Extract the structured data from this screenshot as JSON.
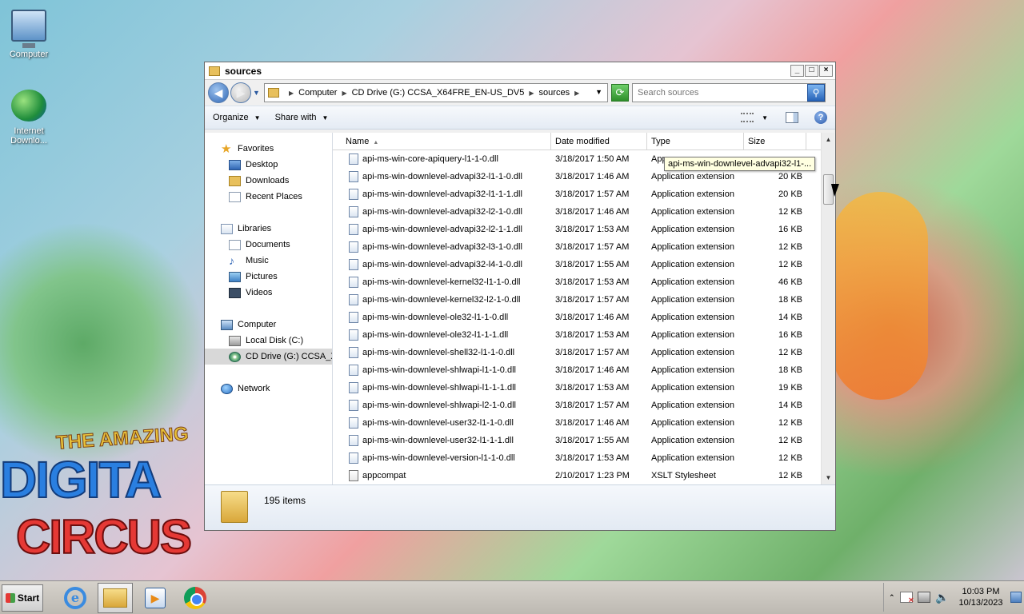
{
  "desktop": {
    "icons": [
      {
        "label": "Computer"
      },
      {
        "label": "Internet Downlo..."
      }
    ],
    "wallpaper_text": {
      "line1": "THE AMAZING",
      "line2": "DIGITA",
      "line3": "CIRCUS"
    }
  },
  "window": {
    "title": "sources",
    "controls": {
      "minimize": "_",
      "maximize": "□",
      "close": "×"
    }
  },
  "navigation": {
    "breadcrumb": [
      "Computer",
      "CD Drive (G:) CCSA_X64FRE_EN-US_DV5",
      "sources"
    ],
    "search_placeholder": "Search sources"
  },
  "command_bar": {
    "organize": "Organize",
    "share_with": "Share with"
  },
  "nav_pane": {
    "favorites": "Favorites",
    "desktop": "Desktop",
    "downloads": "Downloads",
    "recent_places": "Recent Places",
    "libraries": "Libraries",
    "documents": "Documents",
    "music": "Music",
    "pictures": "Pictures",
    "videos": "Videos",
    "computer": "Computer",
    "local_disk": "Local Disk (C:)",
    "cd_drive": "CD Drive (G:) CCSA_X",
    "network": "Network"
  },
  "columns": {
    "name": "Name",
    "date": "Date modified",
    "type": "Type",
    "size": "Size"
  },
  "files": [
    {
      "name": "api-ms-win-core-apiquery-l1-1-0.dll",
      "date": "3/18/2017 1:50 AM",
      "type": "App",
      "size": ""
    },
    {
      "name": "api-ms-win-downlevel-advapi32-l1-1-0.dll",
      "date": "3/18/2017 1:46 AM",
      "type": "Application extension",
      "size": "20 KB"
    },
    {
      "name": "api-ms-win-downlevel-advapi32-l1-1-1.dll",
      "date": "3/18/2017 1:57 AM",
      "type": "Application extension",
      "size": "20 KB"
    },
    {
      "name": "api-ms-win-downlevel-advapi32-l2-1-0.dll",
      "date": "3/18/2017 1:46 AM",
      "type": "Application extension",
      "size": "12 KB"
    },
    {
      "name": "api-ms-win-downlevel-advapi32-l2-1-1.dll",
      "date": "3/18/2017 1:53 AM",
      "type": "Application extension",
      "size": "16 KB"
    },
    {
      "name": "api-ms-win-downlevel-advapi32-l3-1-0.dll",
      "date": "3/18/2017 1:57 AM",
      "type": "Application extension",
      "size": "12 KB"
    },
    {
      "name": "api-ms-win-downlevel-advapi32-l4-1-0.dll",
      "date": "3/18/2017 1:55 AM",
      "type": "Application extension",
      "size": "12 KB"
    },
    {
      "name": "api-ms-win-downlevel-kernel32-l1-1-0.dll",
      "date": "3/18/2017 1:53 AM",
      "type": "Application extension",
      "size": "46 KB"
    },
    {
      "name": "api-ms-win-downlevel-kernel32-l2-1-0.dll",
      "date": "3/18/2017 1:57 AM",
      "type": "Application extension",
      "size": "18 KB"
    },
    {
      "name": "api-ms-win-downlevel-ole32-l1-1-0.dll",
      "date": "3/18/2017 1:46 AM",
      "type": "Application extension",
      "size": "14 KB"
    },
    {
      "name": "api-ms-win-downlevel-ole32-l1-1-1.dll",
      "date": "3/18/2017 1:53 AM",
      "type": "Application extension",
      "size": "16 KB"
    },
    {
      "name": "api-ms-win-downlevel-shell32-l1-1-0.dll",
      "date": "3/18/2017 1:57 AM",
      "type": "Application extension",
      "size": "12 KB"
    },
    {
      "name": "api-ms-win-downlevel-shlwapi-l1-1-0.dll",
      "date": "3/18/2017 1:46 AM",
      "type": "Application extension",
      "size": "18 KB"
    },
    {
      "name": "api-ms-win-downlevel-shlwapi-l1-1-1.dll",
      "date": "3/18/2017 1:53 AM",
      "type": "Application extension",
      "size": "19 KB"
    },
    {
      "name": "api-ms-win-downlevel-shlwapi-l2-1-0.dll",
      "date": "3/18/2017 1:57 AM",
      "type": "Application extension",
      "size": "14 KB"
    },
    {
      "name": "api-ms-win-downlevel-user32-l1-1-0.dll",
      "date": "3/18/2017 1:46 AM",
      "type": "Application extension",
      "size": "12 KB"
    },
    {
      "name": "api-ms-win-downlevel-user32-l1-1-1.dll",
      "date": "3/18/2017 1:55 AM",
      "type": "Application extension",
      "size": "12 KB"
    },
    {
      "name": "api-ms-win-downlevel-version-l1-1-0.dll",
      "date": "3/18/2017 1:53 AM",
      "type": "Application extension",
      "size": "12 KB"
    },
    {
      "name": "appcompat",
      "date": "2/10/2017 1:23 PM",
      "type": "XSLT Stylesheet",
      "size": "12 KB"
    }
  ],
  "tooltip": "api-ms-win-downlevel-advapi32-l1-...",
  "details": {
    "item_count": "195 items"
  },
  "taskbar": {
    "start": "Start",
    "apps": [
      {
        "icon": "internet-explorer-icon"
      },
      {
        "icon": "windows-explorer-icon"
      },
      {
        "icon": "media-player-icon"
      },
      {
        "icon": "chrome-icon"
      }
    ],
    "time": "10:03 PM",
    "date": "10/13/2023"
  }
}
